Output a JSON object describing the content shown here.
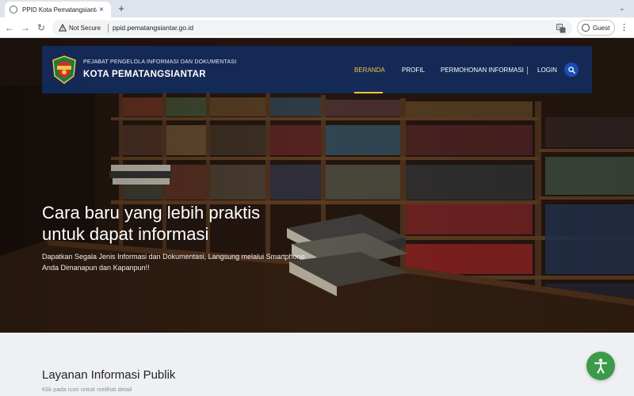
{
  "browser": {
    "tab_title": "PPID Kota Pematangsiantar",
    "tab_close": "×",
    "new_tab": "+",
    "tab_menu": "⌄",
    "back": "←",
    "forward": "→",
    "reload": "↻",
    "security_label": "Not Secure",
    "url": "ppid.pematangsiantar.go.id",
    "profile_label": "Guest",
    "menu": "⋮"
  },
  "header": {
    "org_subtitle": "PEJABAT PENGELOLA INFORMASI DAN DOKUMENTASI",
    "org_name": "KOTA PEMATANGSIANTAR",
    "nav": [
      {
        "label": "BERANDA",
        "active": true
      },
      {
        "label": "PROFIL",
        "active": false
      },
      {
        "label": "PERMOHONAN INFORMASI",
        "active": false
      },
      {
        "label": "LOGIN",
        "active": false
      }
    ],
    "accent_color": "#f3c246",
    "bar_color": "#122e66"
  },
  "hero": {
    "title_line1": "Cara baru yang lebih praktis",
    "title_line2": "untuk dapat informasi",
    "text": "Dapatkan Segala Jenis Informasi dan Dokumentasi, Langsung melalui Smartphone Anda Dimanapun dan Kapanpun!!"
  },
  "services": {
    "title": "Layanan Informasi Publik",
    "subtitle": "Klik pada icon untuk melihat detail"
  },
  "icons": {
    "search": "search-icon",
    "accessibility": "accessibility-icon",
    "translate": "translate-icon",
    "warning": "warning-icon"
  }
}
